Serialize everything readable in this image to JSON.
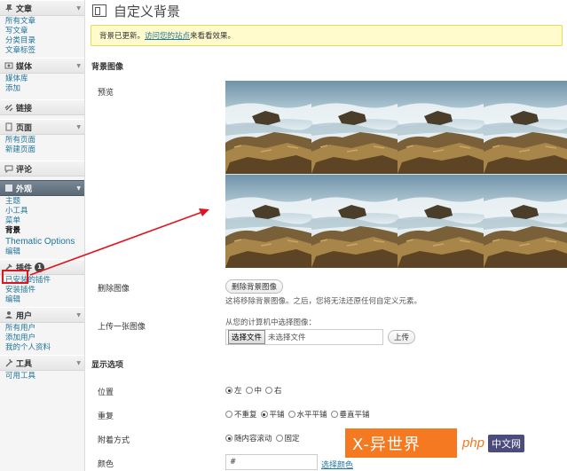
{
  "sidebar": {
    "posts": {
      "label": "文章",
      "items": [
        "所有文章",
        "写文章",
        "分类目录",
        "文章标签"
      ]
    },
    "media": {
      "label": "媒体",
      "items": [
        "媒体库",
        "添加"
      ]
    },
    "links": {
      "label": "链接"
    },
    "pages": {
      "label": "页面",
      "items": [
        "所有页面",
        "新建页面"
      ]
    },
    "comments": {
      "label": "评论"
    },
    "appearance": {
      "label": "外观",
      "items": [
        "主题",
        "小工具",
        "菜单",
        "背景",
        "Thematic Options",
        "编辑"
      ]
    },
    "plugins": {
      "label": "插件",
      "badge": "1",
      "items": [
        "已安装的插件",
        "安装插件",
        "编辑"
      ]
    },
    "users": {
      "label": "用户",
      "items": [
        "所有用户",
        "添加用户",
        "我的个人资料"
      ]
    },
    "tools": {
      "label": "工具",
      "items": [
        "可用工具"
      ]
    }
  },
  "page": {
    "title": "自定义背景",
    "notice_prefix": "背景已更新。",
    "notice_link": "访问您的站点",
    "notice_suffix": "来看看效果。"
  },
  "background_image": {
    "section": "背景图像",
    "preview_label": "预览",
    "remove_label": "删除图像",
    "remove_button": "删除背景图像",
    "remove_desc": "这将移除背景图像。之后，您将无法还原任何自定义元素。",
    "upload_label": "上传一张图像",
    "upload_hint": "从您的计算机中选择图像：",
    "choose_file_button": "选择文件",
    "no_file_text": "未选择文件",
    "upload_button": "上传"
  },
  "display": {
    "section": "显示选项",
    "position_label": "位置",
    "position_options": [
      "左",
      "中",
      "右"
    ],
    "repeat_label": "重复",
    "repeat_options": [
      "不重复",
      "平铺",
      "水平平铺",
      "垂直平铺"
    ],
    "attachment_label": "附着方式",
    "attachment_options": [
      "随内容滚动",
      "固定"
    ],
    "color_label": "颜色",
    "color_value": "#",
    "color_link": "选择颜色"
  },
  "watermark": {
    "part1": "X-异世界",
    "part2": "php",
    "part3": "中文网"
  },
  "colors": {
    "accent": "#21759b",
    "highlight": "#e0141e",
    "notice_bg": "#fffbcc"
  }
}
